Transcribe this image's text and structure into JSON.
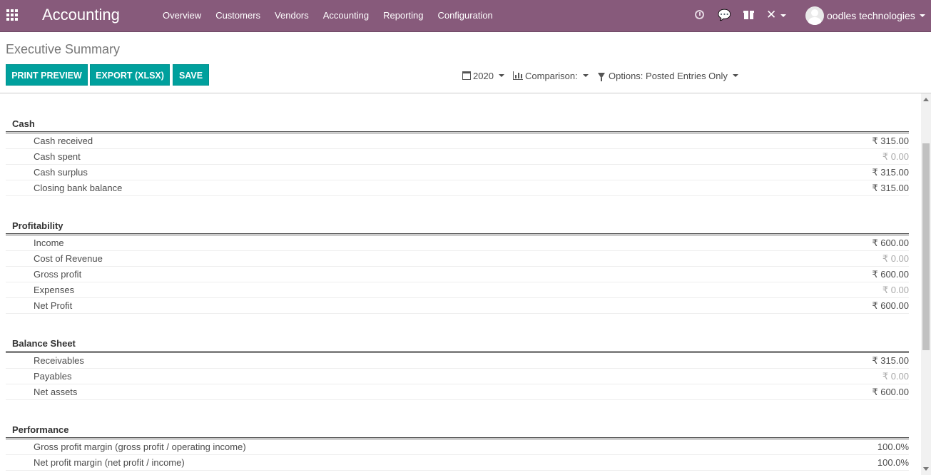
{
  "navbar": {
    "brand": "Accounting",
    "menu": [
      "Overview",
      "Customers",
      "Vendors",
      "Accounting",
      "Reporting",
      "Configuration"
    ],
    "chat_glyph": "💬",
    "tools_glyph": "✕",
    "user_name": "oodles technologies",
    "icons": [
      "apps-grid-icon",
      "clock-icon",
      "chat-icon",
      "gift-icon",
      "tools-icon",
      "avatar"
    ]
  },
  "control_panel": {
    "breadcrumb": "Executive Summary",
    "buttons": {
      "print": "PRINT PREVIEW",
      "export": "EXPORT (XLSX)",
      "save": "SAVE"
    },
    "filters": {
      "date": "2020",
      "comparison": "Comparison:",
      "options": "Options: Posted Entries Only"
    }
  },
  "report": {
    "sections": [
      {
        "title": "Cash",
        "rows": [
          {
            "label": "Cash received",
            "value": "₹ 315.00",
            "muted": false
          },
          {
            "label": "Cash spent",
            "value": "₹ 0.00",
            "muted": true
          },
          {
            "label": "Cash surplus",
            "value": "₹ 315.00",
            "muted": false
          },
          {
            "label": "Closing bank balance",
            "value": "₹ 315.00",
            "muted": false
          }
        ]
      },
      {
        "title": "Profitability",
        "rows": [
          {
            "label": "Income",
            "value": "₹ 600.00",
            "muted": false
          },
          {
            "label": "Cost of Revenue",
            "value": "₹ 0.00",
            "muted": true
          },
          {
            "label": "Gross profit",
            "value": "₹ 600.00",
            "muted": false
          },
          {
            "label": "Expenses",
            "value": "₹ 0.00",
            "muted": true
          },
          {
            "label": "Net Profit",
            "value": "₹ 600.00",
            "muted": false
          }
        ]
      },
      {
        "title": "Balance Sheet",
        "rows": [
          {
            "label": "Receivables",
            "value": "₹ 315.00",
            "muted": false
          },
          {
            "label": "Payables",
            "value": "₹ 0.00",
            "muted": true
          },
          {
            "label": "Net assets",
            "value": "₹ 600.00",
            "muted": false
          }
        ]
      },
      {
        "title": "Performance",
        "rows": [
          {
            "label": "Gross profit margin (gross profit / operating income)",
            "value": "100.0%",
            "muted": false
          },
          {
            "label": "Net profit margin (net profit / income)",
            "value": "100.0%",
            "muted": false
          }
        ]
      }
    ]
  },
  "colors": {
    "navbar": "#875a7b",
    "button": "#00a09d",
    "muted_value": "#aaaaaa"
  }
}
